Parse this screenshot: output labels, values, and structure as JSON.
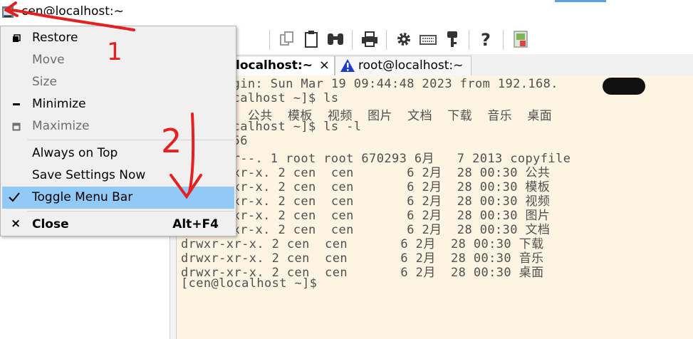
{
  "window": {
    "title": "cen@localhost:~"
  },
  "tabs": [
    {
      "label": "localhost:~",
      "close": "×"
    },
    {
      "label": "root@localhost:~"
    }
  ],
  "menu": {
    "items": [
      {
        "label": "Restore",
        "enabled": true
      },
      {
        "label": "Move",
        "enabled": false
      },
      {
        "label": "Size",
        "enabled": false
      },
      {
        "label": "Minimize",
        "enabled": true
      },
      {
        "label": "Maximize",
        "enabled": false
      },
      {
        "label": "Always on Top",
        "enabled": true
      },
      {
        "label": "Save Settings Now",
        "enabled": true
      },
      {
        "label": "Toggle Menu Bar",
        "enabled": true,
        "checked": true
      },
      {
        "label": "Close",
        "enabled": true,
        "shortcut": "Alt+F4"
      }
    ]
  },
  "terminal": {
    "lines": [
      "ogin: Sun Mar 19 09:44:48 2023 from 192.168.",
      "ocalhost ~]$ ls",
      "e  公共  模板  视频  图片  文档  下载  音乐  桌面",
      "ocalhost ~]$ ls -l",
      "656",
      "-r--. 1 root root 670293 6月   7 2013 copyfile",
      "-xr-x. 2 cen  cen       6 2月  28 00:30 公共",
      "-xr-x. 2 cen  cen       6 2月  28 00:30 模板",
      "-xr-x. 2 cen  cen       6 2月  28 00:30 视频",
      "-xr-x. 2 cen  cen       6 2月  28 00:30 图片",
      "-xr-x. 2 cen  cen       6 2月  28 00:30 文档",
      "drwxr-xr-x. 2 cen  cen       6 2月  28 00:30 下载",
      "drwxr-xr-x. 2 cen  cen       6 2月  28 00:30 音乐",
      "drwxr-xr-x. 2 cen  cen       6 2月  28 00:30 桌面",
      "[cen@localhost ~]$"
    ]
  },
  "annotations": {
    "mark_1": "1",
    "mark_2": "2"
  },
  "colors": {
    "terminal_bg": "#fdf4e3",
    "terminal_fg": "#505050",
    "menu_highlight": "#91c9f7",
    "annotation": "#e52020",
    "warning_icon": "#1e3ccc"
  },
  "icons": {
    "toolbar": [
      "copy-icon",
      "paste-icon",
      "find-icon",
      "print-icon",
      "settings-icon",
      "keyboard-icon",
      "key-icon",
      "help-icon",
      "info-icon"
    ],
    "window": "app-icon"
  }
}
